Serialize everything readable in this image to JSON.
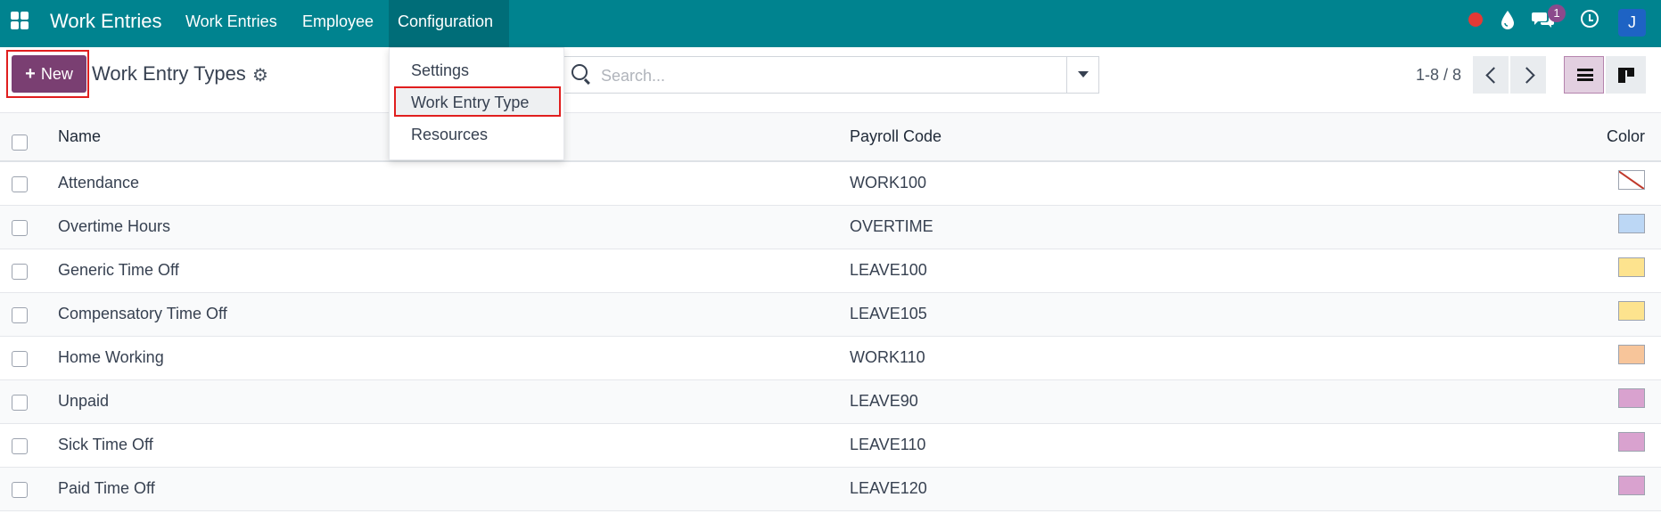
{
  "navbar": {
    "app_title": "Work Entries",
    "menu": [
      "Work Entries",
      "Employee",
      "Configuration"
    ],
    "chat_badge": "1",
    "avatar_initial": "J"
  },
  "control_panel": {
    "new_label": "New",
    "title": "Work Entry Types",
    "search_placeholder": "Search...",
    "pager": "1-8 / 8"
  },
  "dropdown": {
    "items": [
      "Settings",
      "Work Entry Type",
      "Resources"
    ],
    "selected": "Work Entry Type"
  },
  "table": {
    "headers": [
      "Name",
      "Payroll Code",
      "Color"
    ],
    "rows": [
      {
        "name": "Attendance",
        "code": "WORK100",
        "color": "none"
      },
      {
        "name": "Overtime Hours",
        "code": "OVERTIME",
        "color": "#bcd7f5"
      },
      {
        "name": "Generic Time Off",
        "code": "LEAVE100",
        "color": "#fde38e"
      },
      {
        "name": "Compensatory Time Off",
        "code": "LEAVE105",
        "color": "#fde38e"
      },
      {
        "name": "Home Working",
        "code": "WORK110",
        "color": "#f7c59a"
      },
      {
        "name": "Unpaid",
        "code": "LEAVE90",
        "color": "#d9a2cf"
      },
      {
        "name": "Sick Time Off",
        "code": "LEAVE110",
        "color": "#d9a2cf"
      },
      {
        "name": "Paid Time Off",
        "code": "LEAVE120",
        "color": "#d9a2cf"
      }
    ]
  }
}
